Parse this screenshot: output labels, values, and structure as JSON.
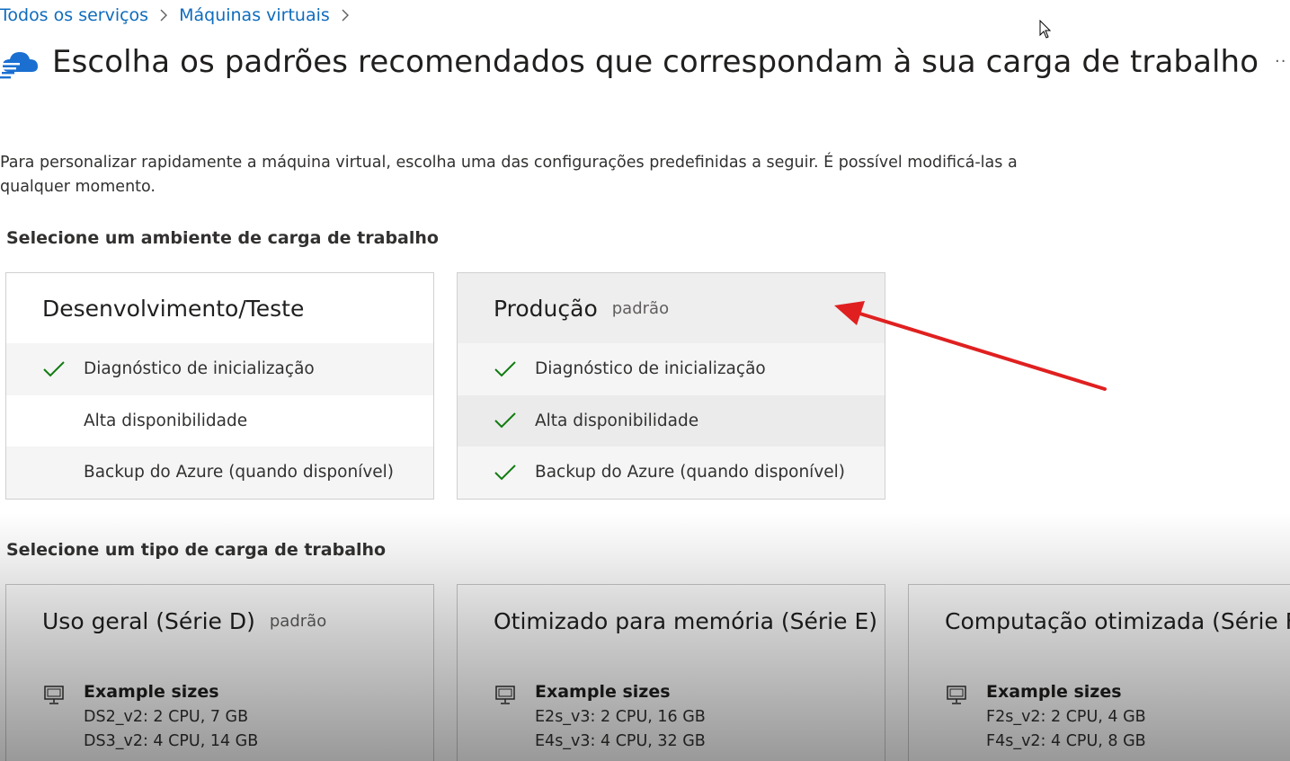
{
  "breadcrumb": {
    "items": [
      "Todos os serviços",
      "Máquinas virtuais"
    ]
  },
  "header": {
    "title": "Escolha os padrões recomendados que correspondam à sua carga de trabalho",
    "more": "··"
  },
  "intro": "Para personalizar rapidamente a máquina virtual, escolha uma das configurações predefinidas a seguir. É possível modificá-las a qualquer momento.",
  "environment_section": {
    "heading": "Selecione um ambiente de carga de trabalho",
    "cards": [
      {
        "title": "Desenvolvimento/Teste",
        "tag": "",
        "selected": false,
        "features": [
          {
            "label": "Diagnóstico de inicialização",
            "checked": true
          },
          {
            "label": "Alta disponibilidade",
            "checked": false
          },
          {
            "label": "Backup do Azure (quando disponível)",
            "checked": false
          }
        ]
      },
      {
        "title": "Produção",
        "tag": "padrão",
        "selected": true,
        "features": [
          {
            "label": "Diagnóstico de inicialização",
            "checked": true
          },
          {
            "label": "Alta disponibilidade",
            "checked": true
          },
          {
            "label": "Backup do Azure (quando disponível)",
            "checked": true
          }
        ]
      }
    ]
  },
  "workload_section": {
    "heading": "Selecione um tipo de carga de trabalho",
    "cards": [
      {
        "title": "Uso geral (Série D)",
        "tag": "padrão",
        "sizes_label": "Example sizes",
        "sizes": [
          "DS2_v2: 2 CPU, 7 GB",
          "DS3_v2: 4 CPU, 14 GB"
        ]
      },
      {
        "title": "Otimizado para memória (Série E)",
        "tag": "",
        "sizes_label": "Example sizes",
        "sizes": [
          "E2s_v3: 2 CPU, 16 GB",
          "E4s_v3: 4 CPU, 32 GB"
        ]
      },
      {
        "title": "Computação otimizada (Série F)",
        "tag": "",
        "sizes_label": "Example sizes",
        "sizes": [
          "F2s_v2: 2 CPU, 4 GB",
          "F4s_v2: 4 CPU, 8 GB"
        ]
      }
    ]
  },
  "icons": {
    "service": "cloud-icon",
    "check": "checkmark-icon",
    "sizes": "monitor-icon",
    "annotation": "red-arrow"
  },
  "colors": {
    "link": "#0f6cbd",
    "check": "#107c10",
    "annotation_arrow": "#e02020",
    "cloud": "#1a6fd1"
  }
}
